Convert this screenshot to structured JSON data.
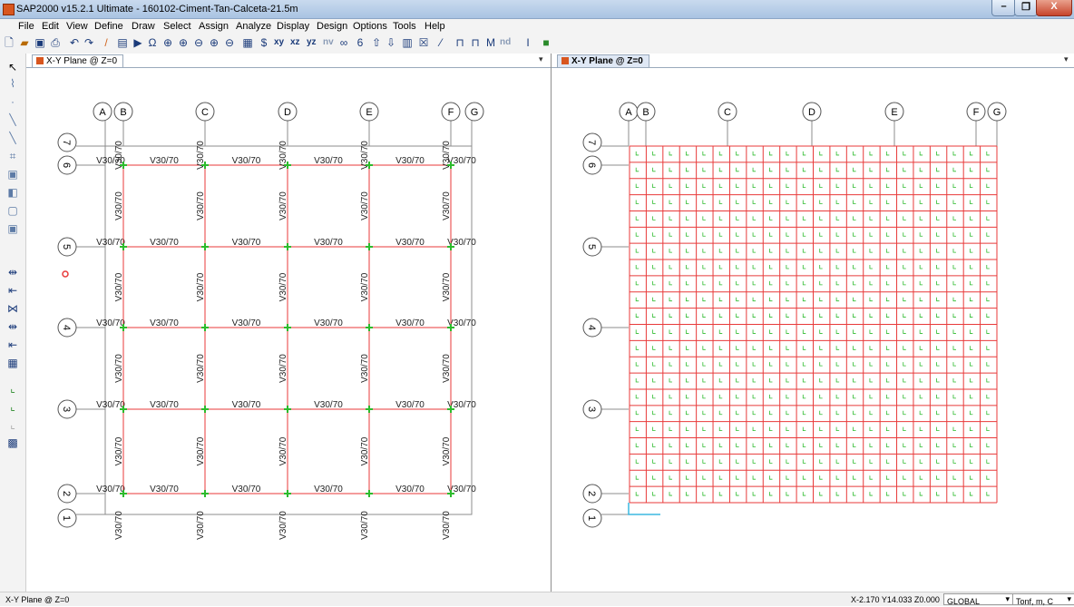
{
  "window": {
    "title": "SAP2000 v15.2.1 Ultimate  - 160102-Ciment-Tan-Calceta-21.5m"
  },
  "menu": [
    "File",
    "Edit",
    "View",
    "Define",
    "Draw",
    "Select",
    "Assign",
    "Analyze",
    "Display",
    "Design",
    "Options",
    "Tools",
    "Help"
  ],
  "toolbar": {
    "xy": "xy",
    "xz": "xz",
    "yz": "yz",
    "nv": "nv",
    "nd": "nd"
  },
  "panes": {
    "left": {
      "tab_label": "X-Y Plane @ Z=0"
    },
    "right": {
      "tab_label": "X-Y Plane @ Z=0"
    }
  },
  "grid": {
    "x_labels": [
      "A",
      "B",
      "C",
      "D",
      "E",
      "F",
      "G"
    ],
    "y_labels": [
      "7",
      "6",
      "5",
      "4",
      "3",
      "2",
      "1"
    ]
  },
  "frame_label": "V30/70",
  "status": {
    "view": "X-Y Plane @ Z=0",
    "coords": "X-2.170 Y14.033 Z0.000",
    "csys": "GLOBAL",
    "units": "Tonf, m, C"
  },
  "colors": {
    "frame": "#e83a3a",
    "joint": "#2dbb2d",
    "grid": "#8c8c8c",
    "accent": "#d8561f"
  }
}
